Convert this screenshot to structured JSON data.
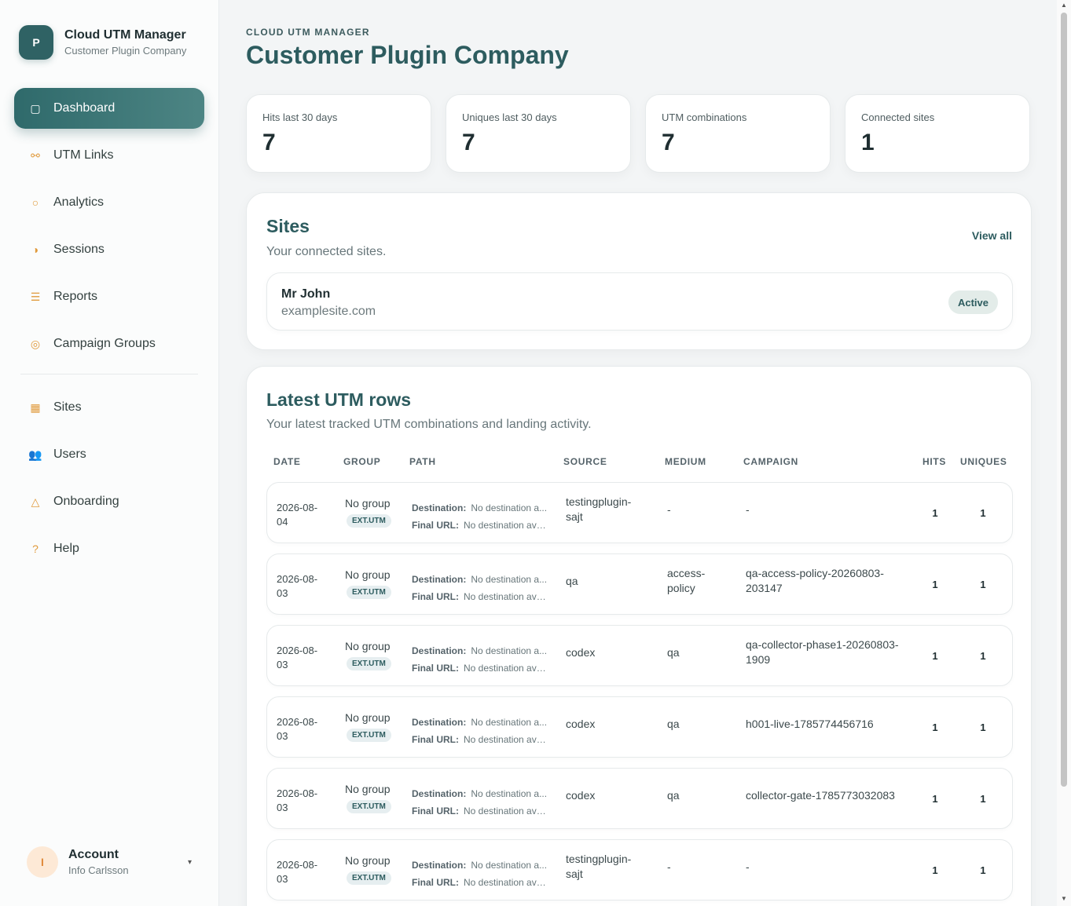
{
  "brand": {
    "logo_letter": "P",
    "title": "Cloud UTM Manager",
    "subtitle": "Customer Plugin Company"
  },
  "nav": {
    "items": [
      {
        "label": "Dashboard",
        "icon": "square-icon",
        "glyph": "▢",
        "active": true
      },
      {
        "label": "UTM Links",
        "icon": "link-icon",
        "glyph": "⚯"
      },
      {
        "label": "Analytics",
        "icon": "circle-icon",
        "glyph": "○"
      },
      {
        "label": "Sessions",
        "icon": "half-circle-icon",
        "glyph": "◑"
      },
      {
        "label": "Reports",
        "icon": "list-icon",
        "glyph": "☰"
      },
      {
        "label": "Campaign Groups",
        "icon": "target-icon",
        "glyph": "◎"
      }
    ],
    "items2": [
      {
        "label": "Sites",
        "icon": "grid-icon",
        "glyph": "▦"
      },
      {
        "label": "Users",
        "icon": "users-icon",
        "glyph": "👥"
      },
      {
        "label": "Onboarding",
        "icon": "triangle-icon",
        "glyph": "△"
      },
      {
        "label": "Help",
        "icon": "help-icon",
        "glyph": "?"
      }
    ]
  },
  "account": {
    "initial": "I",
    "title": "Account",
    "name": "Info Carlsson",
    "caret": "▾"
  },
  "header": {
    "eyebrow": "CLOUD UTM MANAGER",
    "title": "Customer Plugin Company"
  },
  "stats": [
    {
      "label": "Hits last 30 days",
      "value": "7"
    },
    {
      "label": "Uniques last 30 days",
      "value": "7"
    },
    {
      "label": "UTM combinations",
      "value": "7"
    },
    {
      "label": "Connected sites",
      "value": "1"
    }
  ],
  "sites": {
    "title": "Sites",
    "subtitle": "Your connected sites.",
    "view_all": "View all",
    "site": {
      "name": "Mr John",
      "domain": "examplesite.com",
      "status": "Active"
    }
  },
  "utm": {
    "title": "Latest UTM rows",
    "subtitle": "Your latest tracked UTM combinations and landing activity.",
    "columns": [
      "DATE",
      "GROUP",
      "PATH",
      "SOURCE",
      "MEDIUM",
      "CAMPAIGN",
      "HITS",
      "UNIQUES"
    ],
    "dest_label": "Destination:",
    "final_label": "Final URL:",
    "rows": [
      {
        "date1": "2026-08-",
        "date2": "04",
        "group": "No group",
        "badge": "EXT.UTM",
        "dest": "No destination a...",
        "final": "No destination avai...",
        "source1": "testingplugin-",
        "source2": "sajt",
        "medium1": "-",
        "medium2": "",
        "campaign1": "-",
        "campaign2": "",
        "hits": "1",
        "uniques": "1"
      },
      {
        "date1": "2026-08-",
        "date2": "03",
        "group": "No group",
        "badge": "EXT.UTM",
        "dest": "No destination a...",
        "final": "No destination avai...",
        "source1": "qa",
        "source2": "",
        "medium1": "access-",
        "medium2": "policy",
        "campaign1": "qa-access-policy-20260803-",
        "campaign2": "203147",
        "hits": "1",
        "uniques": "1"
      },
      {
        "date1": "2026-08-",
        "date2": "03",
        "group": "No group",
        "badge": "EXT.UTM",
        "dest": "No destination a...",
        "final": "No destination avai...",
        "source1": "codex",
        "source2": "",
        "medium1": "qa",
        "medium2": "",
        "campaign1": "qa-collector-phase1-20260803-",
        "campaign2": "1909",
        "hits": "1",
        "uniques": "1"
      },
      {
        "date1": "2026-08-",
        "date2": "03",
        "group": "No group",
        "badge": "EXT.UTM",
        "dest": "No destination a...",
        "final": "No destination avai...",
        "source1": "codex",
        "source2": "",
        "medium1": "qa",
        "medium2": "",
        "campaign1": "h001-live-1785774456716",
        "campaign2": "",
        "hits": "1",
        "uniques": "1"
      },
      {
        "date1": "2026-08-",
        "date2": "03",
        "group": "No group",
        "badge": "EXT.UTM",
        "dest": "No destination a...",
        "final": "No destination avai...",
        "source1": "codex",
        "source2": "",
        "medium1": "qa",
        "medium2": "",
        "campaign1": "collector-gate-1785773032083",
        "campaign2": "",
        "hits": "1",
        "uniques": "1"
      },
      {
        "date1": "2026-08-",
        "date2": "03",
        "group": "No group",
        "badge": "EXT.UTM",
        "dest": "No destination a...",
        "final": "No destination avai...",
        "source1": "testingplugin-",
        "source2": "sajt",
        "medium1": "-",
        "medium2": "",
        "campaign1": "-",
        "campaign2": "",
        "hits": "1",
        "uniques": "1"
      }
    ]
  }
}
